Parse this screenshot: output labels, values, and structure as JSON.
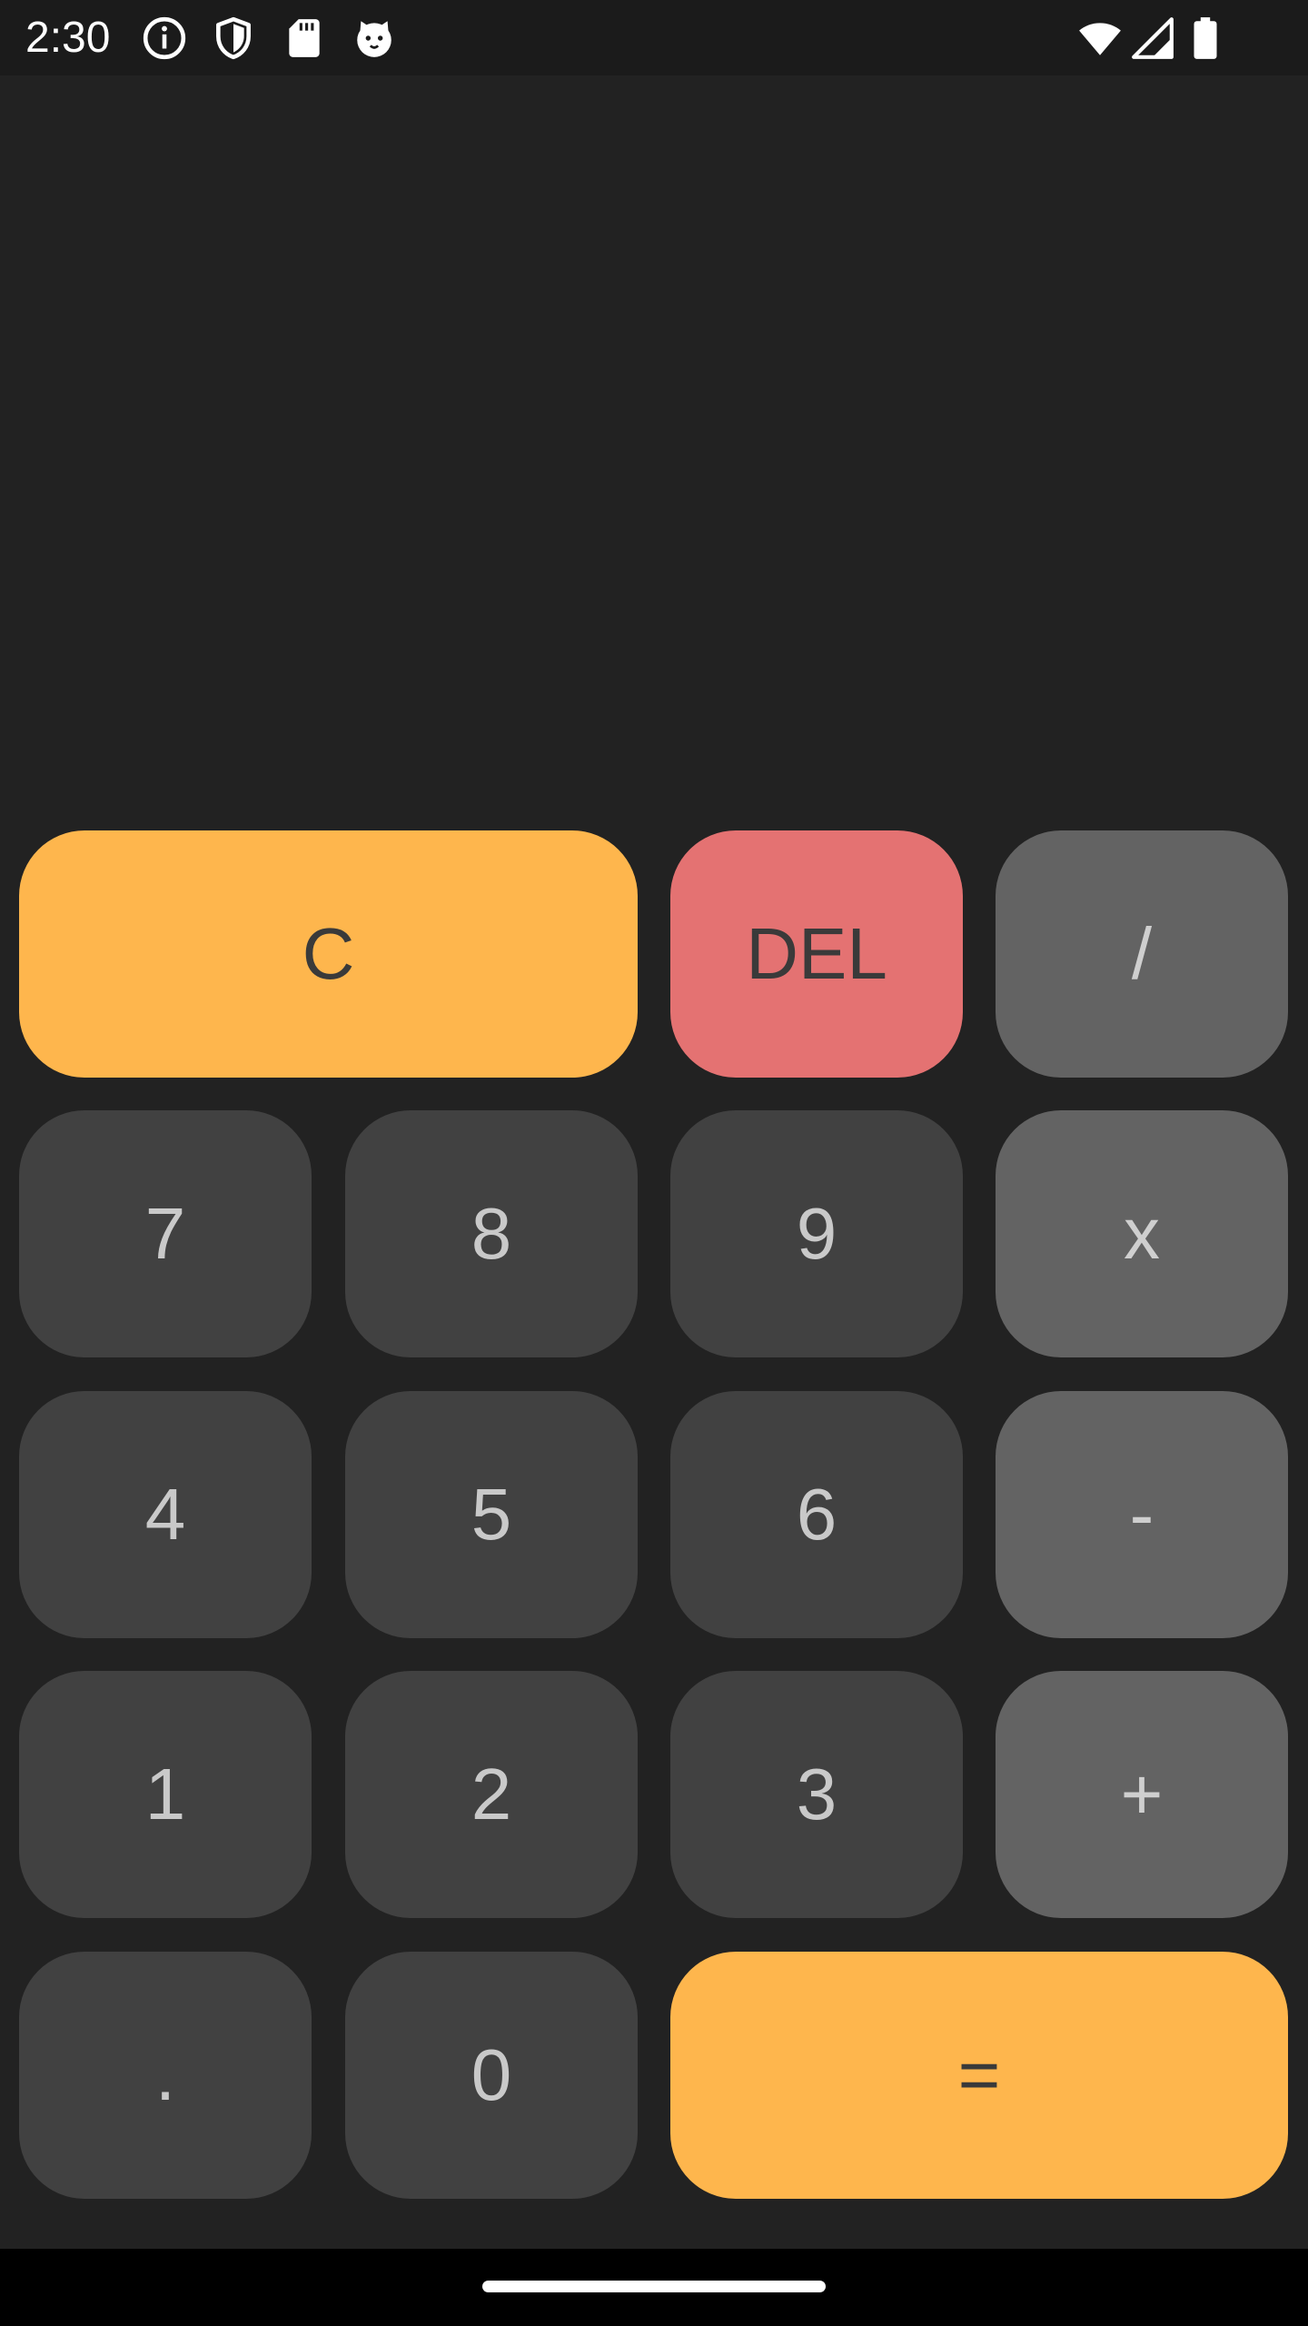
{
  "status_bar": {
    "time": "2:30",
    "left_icons": [
      "info-icon",
      "shield-icon",
      "sd-card-icon",
      "cat-face-icon"
    ],
    "right_icons": [
      "wifi-icon",
      "signal-icon",
      "battery-icon"
    ]
  },
  "display": {
    "expression": "",
    "result": ""
  },
  "keypad": {
    "clear": "C",
    "delete": "DEL",
    "divide": "/",
    "seven": "7",
    "eight": "8",
    "nine": "9",
    "multiply": "x",
    "four": "4",
    "five": "5",
    "six": "6",
    "subtract": "-",
    "one": "1",
    "two": "2",
    "three": "3",
    "add": "+",
    "decimal": ".",
    "zero": "0",
    "equals": "="
  },
  "colors": {
    "background": "#222222",
    "number_key": "#414141",
    "operator_key": "#636363",
    "accent_key": "#feb64d",
    "delete_key": "#e47272"
  }
}
